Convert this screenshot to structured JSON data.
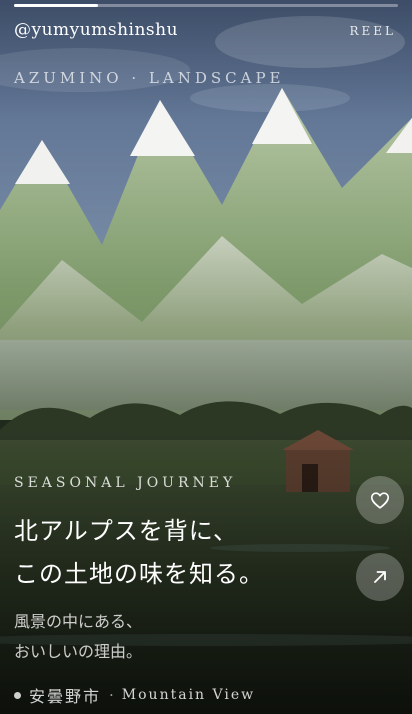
{
  "header": {
    "handle": "@yumyumshinshu",
    "media_type": "REEL",
    "progress": 0.22
  },
  "scene": {
    "location_label": "AZUMINO · LANDSCAPE"
  },
  "caption": {
    "eyebrow": "SEASONAL JOURNEY",
    "headline_line1": "北アルプスを背に、",
    "headline_line2": "この土地の味を知る。",
    "sub_line1": "風景の中にある、",
    "sub_line2": "おいしいの理由。"
  },
  "footer": {
    "city": "安曇野市",
    "separator": "·",
    "place": "Mountain View"
  },
  "actions": {
    "like_icon": "heart-icon",
    "share_icon": "arrow-up-right-icon"
  },
  "colors": {
    "sky_top": "#55698a",
    "sky_bottom": "#8da1b8",
    "mountain": "#7f9b70",
    "forest": "#2f3a26",
    "barn": "#5a3e2e"
  }
}
